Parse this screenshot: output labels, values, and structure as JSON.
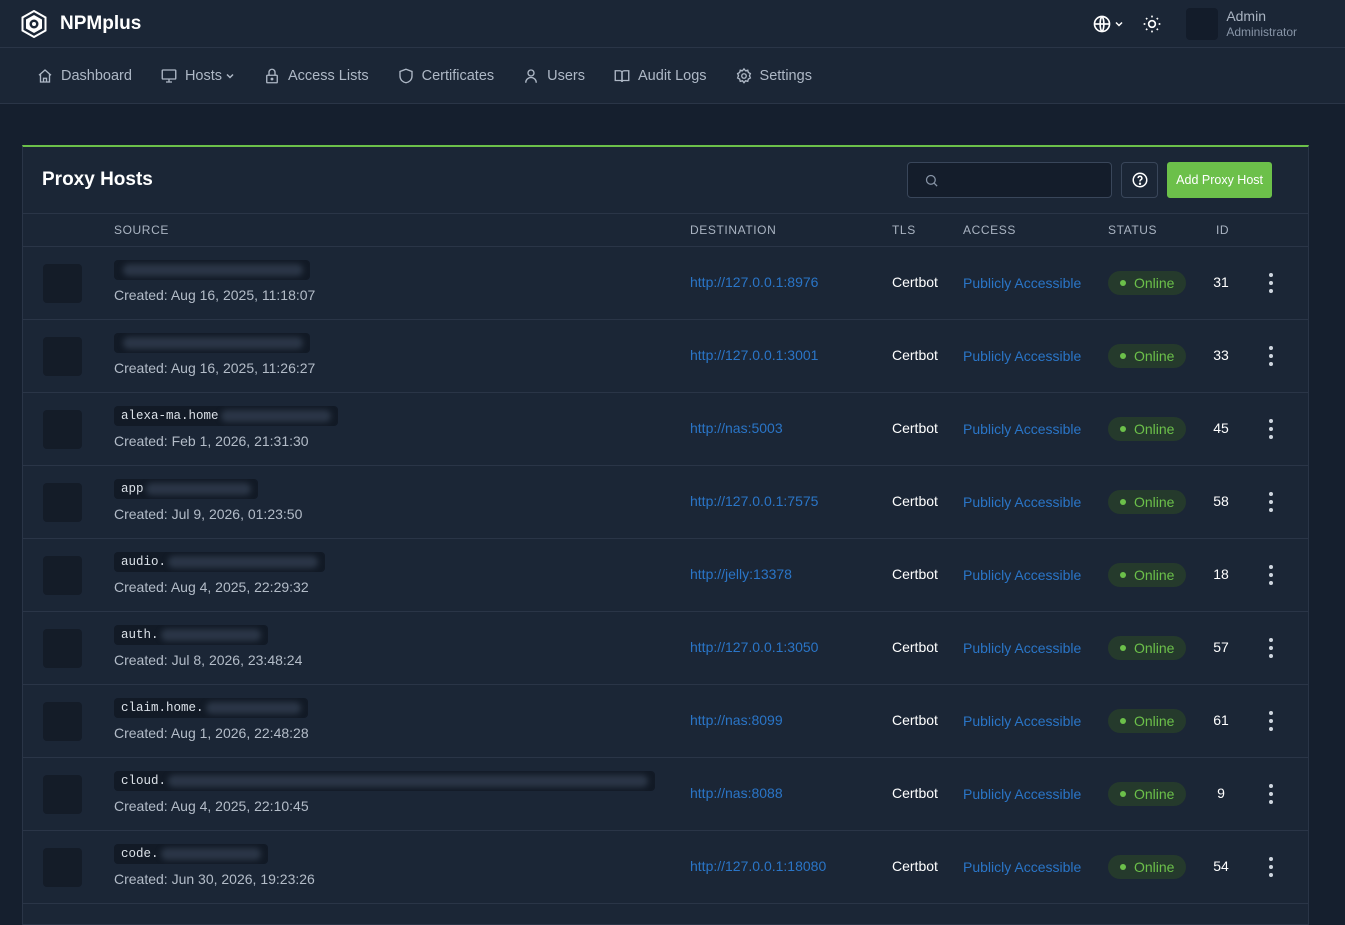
{
  "app": {
    "name": "NPMplus"
  },
  "user": {
    "name": "Admin",
    "role": "Administrator"
  },
  "nav": [
    {
      "label": "Dashboard",
      "icon": "home-icon"
    },
    {
      "label": "Hosts",
      "icon": "monitor-icon"
    },
    {
      "label": "Access Lists",
      "icon": "lock-icon"
    },
    {
      "label": "Certificates",
      "icon": "shield-icon"
    },
    {
      "label": "Users",
      "icon": "user-icon"
    },
    {
      "label": "Audit Logs",
      "icon": "book-icon"
    },
    {
      "label": "Settings",
      "icon": "gear-icon"
    }
  ],
  "page": {
    "title": "Proxy Hosts",
    "search_value": "",
    "add_label": "Add Proxy Host"
  },
  "columns": {
    "source": "SOURCE",
    "destination": "DESTINATION",
    "tls": "TLS",
    "access": "ACCESS",
    "status": "STATUS",
    "id": "ID"
  },
  "rows": [
    {
      "domain": "",
      "created": "Created: Aug 16, 2025, 11:18:07",
      "destination": "http://127.0.0.1:8976",
      "tls": "Certbot",
      "access": "Publicly Accessible",
      "status": "Online",
      "id": "31"
    },
    {
      "domain": "",
      "created": "Created: Aug 16, 2025, 11:26:27",
      "destination": "http://127.0.0.1:3001",
      "tls": "Certbot",
      "access": "Publicly Accessible",
      "status": "Online",
      "id": "33"
    },
    {
      "domain": "alexa-ma.home",
      "created": "Created: Feb 1, 2026, 21:31:30",
      "destination": "http://nas:5003",
      "tls": "Certbot",
      "access": "Publicly Accessible",
      "status": "Online",
      "id": "45"
    },
    {
      "domain": "app",
      "created": "Created: Jul 9, 2026, 01:23:50",
      "destination": "http://127.0.0.1:7575",
      "tls": "Certbot",
      "access": "Publicly Accessible",
      "status": "Online",
      "id": "58"
    },
    {
      "domain": "audio.",
      "created": "Created: Aug 4, 2025, 22:29:32",
      "destination": "http://jelly:13378",
      "tls": "Certbot",
      "access": "Publicly Accessible",
      "status": "Online",
      "id": "18"
    },
    {
      "domain": "auth.",
      "created": "Created: Jul 8, 2026, 23:48:24",
      "destination": "http://127.0.0.1:3050",
      "tls": "Certbot",
      "access": "Publicly Accessible",
      "status": "Online",
      "id": "57"
    },
    {
      "domain": "claim.home.",
      "created": "Created: Aug 1, 2026, 22:48:28",
      "destination": "http://nas:8099",
      "tls": "Certbot",
      "access": "Publicly Accessible",
      "status": "Online",
      "id": "61"
    },
    {
      "domain": "cloud.",
      "created": "Created: Aug 4, 2025, 22:10:45",
      "destination": "http://nas:8088",
      "tls": "Certbot",
      "access": "Publicly Accessible",
      "status": "Online",
      "id": "9"
    },
    {
      "domain": "code.",
      "created": "Created: Jun 30, 2026, 19:23:26",
      "destination": "http://127.0.0.1:18080",
      "tls": "Certbot",
      "access": "Publicly Accessible",
      "status": "Online",
      "id": "54"
    }
  ],
  "colors": {
    "accent": "#6cc04a",
    "link": "#2a75c7",
    "background": "#151f2e",
    "panel": "#1b2636"
  }
}
